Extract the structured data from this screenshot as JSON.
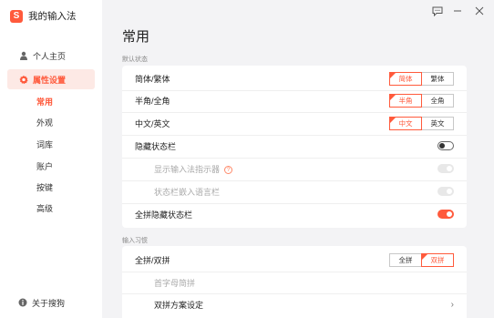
{
  "app": {
    "title": "我的输入法",
    "logo_glyph": "S",
    "accent_color": "#ff5a3c"
  },
  "sidebar": {
    "items": [
      {
        "label": "个人主页",
        "icon": "user-icon"
      },
      {
        "label": "属性设置",
        "icon": "settings-icon",
        "selected": true
      }
    ],
    "sub_items": [
      "常用",
      "外观",
      "词库",
      "账户",
      "按键",
      "高级"
    ],
    "active_sub_item": "常用",
    "footer_item": {
      "label": "关于搜狗",
      "icon": "info-icon"
    }
  },
  "window_controls": [
    "feedback-icon",
    "minimize-icon",
    "close-icon"
  ],
  "page": {
    "title": "常用"
  },
  "sections": {
    "status": {
      "label": "默认状态",
      "rows": {
        "simp_trad": {
          "label": "简体/繁体",
          "options": [
            "简体",
            "繁体"
          ],
          "selected": "简体"
        },
        "half_full": {
          "label": "半角/全角",
          "options": [
            "半角",
            "全角"
          ],
          "selected": "半角"
        },
        "cn_en": {
          "label": "中文/英文",
          "options": [
            "中文",
            "英文"
          ],
          "selected": "中文"
        },
        "hide_status_bar": {
          "label": "隐藏状态栏",
          "value": false
        },
        "show_indicator": {
          "label": "显示输入法指示器",
          "value": true,
          "disabled": true,
          "help": "?"
        },
        "embed_lang_bar": {
          "label": "状态栏嵌入语言栏",
          "value": true,
          "disabled": true
        },
        "full_pinyin_hide": {
          "label": "全拼隐藏状态栏",
          "value": true
        }
      }
    },
    "input": {
      "label": "输入习惯",
      "rows": {
        "pinyin_mode": {
          "label": "全拼/双拼",
          "options": [
            "全拼",
            "双拼"
          ],
          "selected": "双拼"
        },
        "initial_abbrev": {
          "label": "首字母简拼",
          "disabled": true
        },
        "shuangpin_scheme": {
          "label": "双拼方案设定"
        }
      }
    }
  }
}
